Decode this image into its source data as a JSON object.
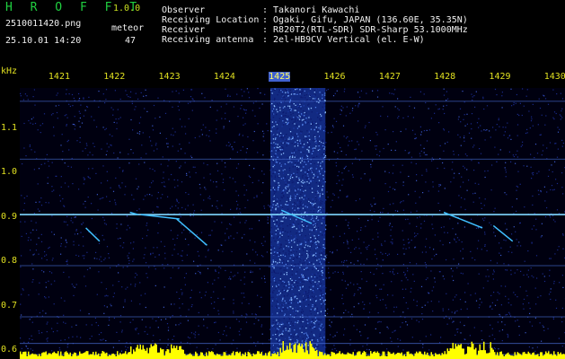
{
  "header": {
    "app_title": "H R O F F T",
    "version": "1.0.0",
    "file_name": "2510011420.png",
    "mode_label": "meteor",
    "datetime": "25.10.01 14:20",
    "meteor_count": "47",
    "info_rows": [
      {
        "key": "Observer",
        "value": ": Takanori Kawachi"
      },
      {
        "key": "Receiving Location",
        "value": ": Ogaki, Gifu, JAPAN (136.60E, 35.35N)"
      },
      {
        "key": "Receiver",
        "value": ": R820T2(RTL-SDR) SDR-Sharp 53.1000MHz"
      },
      {
        "key": "Receiving antenna",
        "value": ": 2el-HB9CV Vertical (el. E-W)"
      }
    ]
  },
  "colors": {
    "label": "#e0e020",
    "title": "#20d040",
    "background": "#000010",
    "noise": "#1a2a8a",
    "signal": "#40c0ff",
    "marker": "#ffff00"
  },
  "chart_data": {
    "type": "heatmap",
    "xlabel": "",
    "ylabel": "kHz",
    "x_ticks": [
      "1421",
      "1422",
      "1423",
      "1424",
      "1425",
      "1426",
      "1427",
      "1428",
      "1429",
      "1430"
    ],
    "x_range": [
      1420.3,
      1430.2
    ],
    "y_ticks": [
      "1.1",
      "1.0",
      "0.9",
      "0.8",
      "0.7",
      "0.6"
    ],
    "y_range": [
      0.58,
      1.19
    ],
    "highlight_x": "1425",
    "carrier_lines_khz": [
      1.16,
      1.03,
      0.905,
      0.79,
      0.675,
      0.615,
      0.59
    ],
    "strong_carrier_khz": 0.905,
    "noise_band_minutes": [
      1424.85,
      1425.85
    ],
    "meteor_traces": [
      {
        "x": [
          1421.5,
          1421.75
        ],
        "y": [
          0.875,
          0.845
        ]
      },
      {
        "x": [
          1422.3,
          1422.45
        ],
        "y": [
          0.91,
          0.905
        ]
      },
      {
        "x": [
          1422.5,
          1423.2
        ],
        "y": [
          0.905,
          0.895
        ]
      },
      {
        "x": [
          1423.15,
          1423.7
        ],
        "y": [
          0.895,
          0.836
        ]
      },
      {
        "x": [
          1425.05,
          1425.6
        ],
        "y": [
          0.915,
          0.885
        ]
      },
      {
        "x": [
          1428.0,
          1428.3
        ],
        "y": [
          0.91,
          0.895
        ]
      },
      {
        "x": [
          1428.3,
          1428.7
        ],
        "y": [
          0.895,
          0.875
        ]
      },
      {
        "x": [
          1428.9,
          1429.25
        ],
        "y": [
          0.88,
          0.845
        ]
      }
    ]
  }
}
